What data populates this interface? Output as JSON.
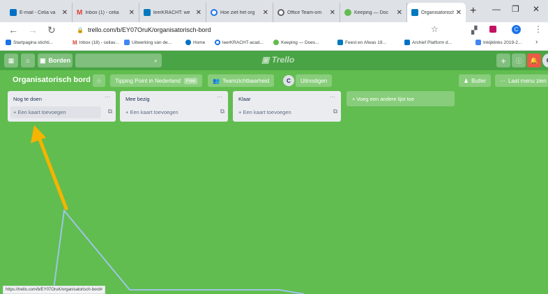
{
  "browser": {
    "tabs": [
      {
        "label": "E-mail - Celia va",
        "color": "#0072c6",
        "active": false
      },
      {
        "label": "Inbox (1) - celia",
        "color": "#db4437",
        "active": false
      },
      {
        "label": "leerKRACHT: we",
        "color": "#0079bf",
        "active": false
      },
      {
        "label": "Hoe ziet het org",
        "color": "#1a73e8",
        "active": false
      },
      {
        "label": "Office Team-om",
        "color": "#5f6368",
        "active": false
      },
      {
        "label": "Keeping — Doc",
        "color": "#61bd4f",
        "active": false
      },
      {
        "label": "Organisatorisch",
        "color": "#0079bf",
        "active": true
      }
    ],
    "new_tab": "+",
    "url": "trello.com/b/EY07OruK/organisatorisch-bord",
    "bookmarks": [
      {
        "label": "Startpagina stichti...",
        "color": "#1a73e8"
      },
      {
        "label": "Inbox (18) - celiav...",
        "color": "#db4437"
      },
      {
        "label": "Uitwerking van de...",
        "color": "#4285f4"
      },
      {
        "label": "Home",
        "color": "#0072c6"
      },
      {
        "label": "leerKRACHT-acad...",
        "color": "#1a73e8"
      },
      {
        "label": "Keeping — Does...",
        "color": "#61bd4f"
      },
      {
        "label": "Feest en Afwas 19...",
        "color": "#0079bf"
      },
      {
        "label": "Archief Platform d...",
        "color": "#0072c6"
      },
      {
        "label": "Inkijklinks 2019-2...",
        "color": "#4285f4"
      }
    ]
  },
  "trello": {
    "boards_label": "Borden",
    "logo": "Trello",
    "board_title": "Organisatorisch bord",
    "team_label": "Tipping Point in Nederland",
    "team_badge": "Free",
    "visibility_label": "Teamzichtbaarheid",
    "avatar_initial": "C",
    "invite_label": "Uitnodigen",
    "butler_label": "Butler",
    "menu_label": "Laat menu zien",
    "lists": [
      {
        "title": "Nog te doen",
        "add_card": "+ Een kaart toevoegen"
      },
      {
        "title": "Mee bezig",
        "add_card": "+ Een kaart toevoegen"
      },
      {
        "title": "Klaar",
        "add_card": "+ Een kaart toevoegen"
      }
    ],
    "add_list": "+ Voeg een andere lijst toe"
  },
  "status_url": "https://trello.com/b/EY07OruK/organisatorisch-bord#",
  "colors": {
    "header": "#49a445",
    "board_bg": "#61bd4f",
    "arrow": "#f4b400",
    "notification": "#eb5a46"
  }
}
